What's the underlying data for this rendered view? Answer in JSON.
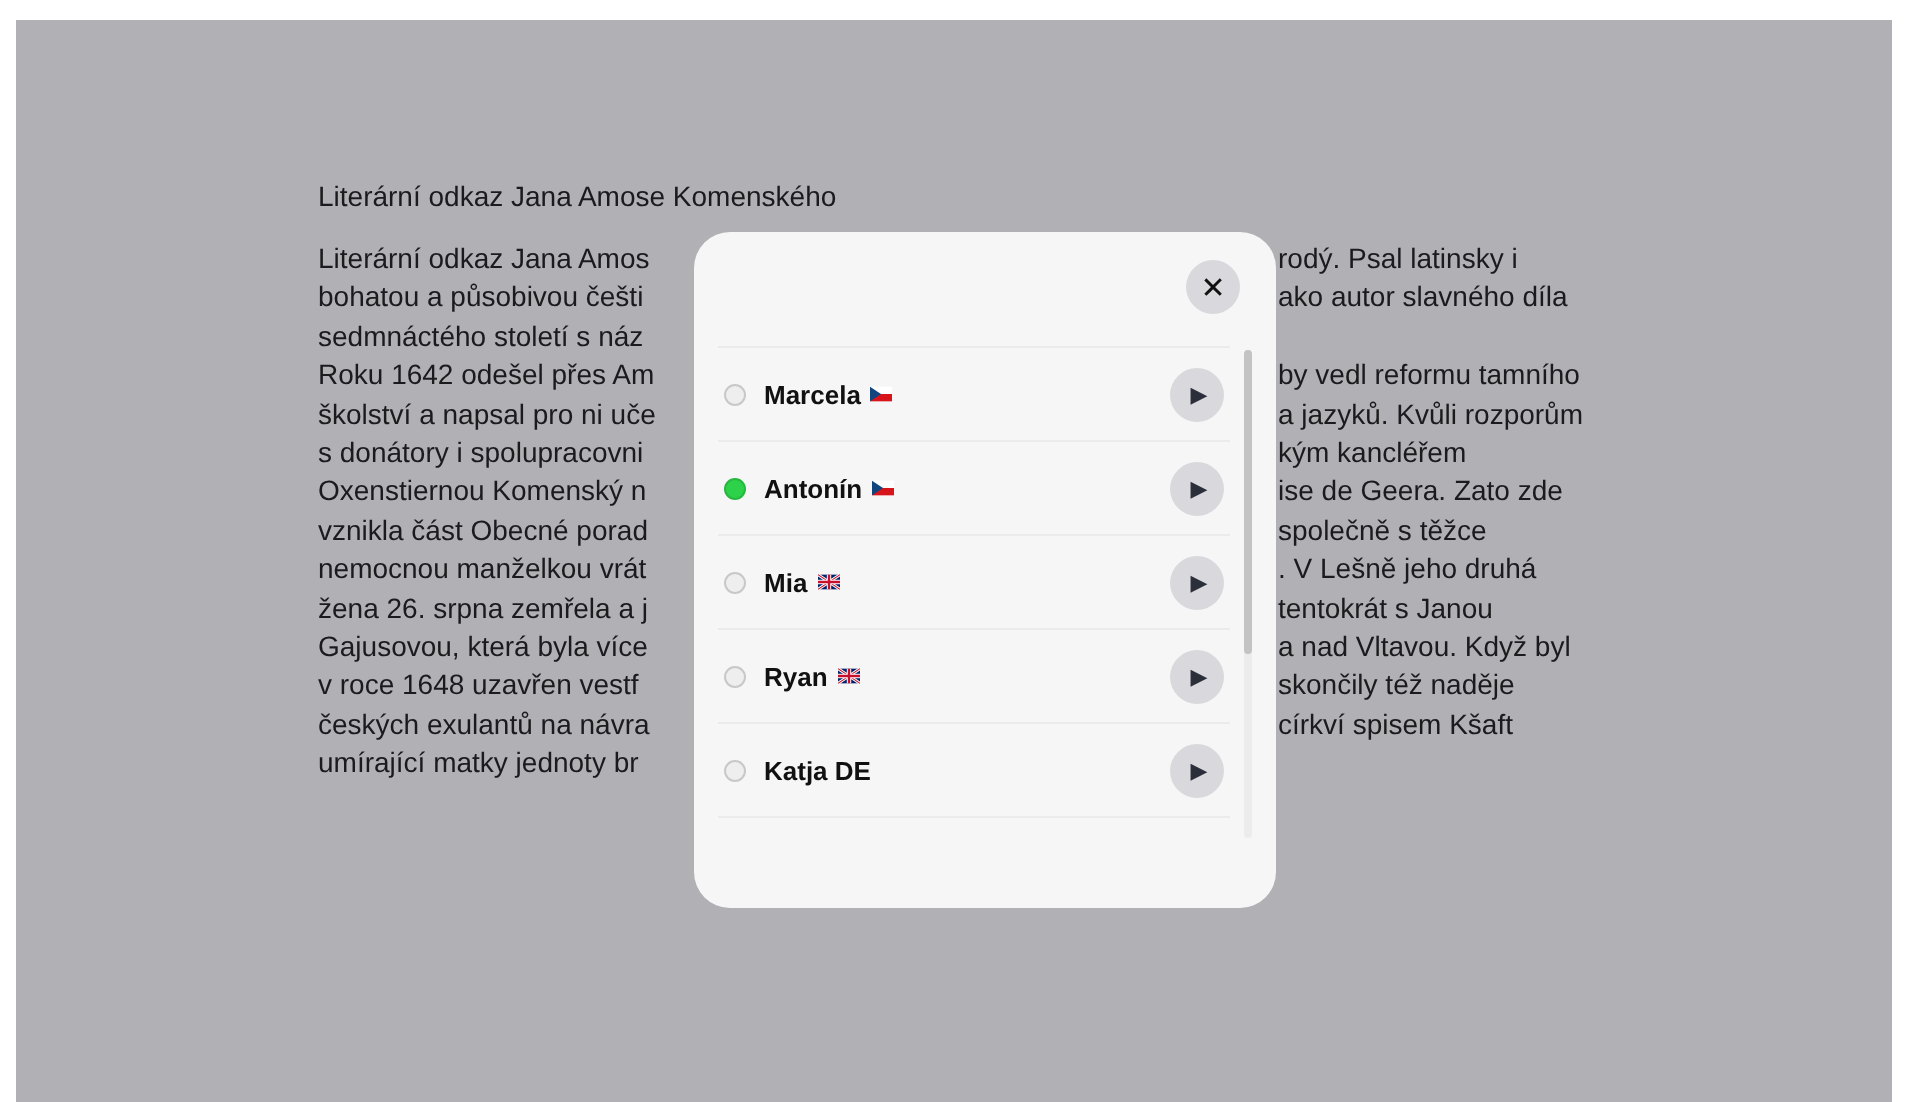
{
  "article": {
    "title": "Literární odkaz Jana Amose Komenského",
    "lines": [
      {
        "left": "Literární odkaz Jana Amos",
        "right": "rodý. Psal latinsky i"
      },
      {
        "left": "bohatou a působivou češti",
        "right": "ako autor slavného díla"
      },
      {
        "left": "sedmnáctého století s náz"
      },
      {
        "left": "Roku 1642 odešel přes Am",
        "right": "by vedl reformu tamního"
      },
      {
        "left": "školství a napsal pro ni uče",
        "right": "a jazyků. Kvůli rozporům"
      },
      {
        "left": "s donátory i spolupracovni",
        "right": "kým kancléřem"
      },
      {
        "left": "Oxenstiernou Komenský n",
        "right": "ise de Geera. Zato zde"
      },
      {
        "left": "vznikla část Obecné porad",
        "right": "společně s těžce"
      },
      {
        "left": "nemocnou manželkou vrát",
        "right": ". V Lešně jeho druhá"
      },
      {
        "left": "žena 26. srpna zemřela a j",
        "right": "tentokrát s Janou"
      },
      {
        "left": "Gajusovou, která byla více",
        "right": "a nad Vltavou. Když byl"
      },
      {
        "left": "v roce 1648 uzavřen vestf",
        "right": "skončily též naděje"
      },
      {
        "left": "českých exulantů na návra",
        "right": "církví spisem Kšaft"
      },
      {
        "left": "umírající matky jednoty br"
      }
    ]
  },
  "dialog": {
    "close": "✕",
    "voices": [
      {
        "name": "Marcela",
        "kind": "cz",
        "selected": false,
        "play": "▶"
      },
      {
        "name": "Antonín",
        "kind": "cz",
        "selected": true,
        "play": "▶"
      },
      {
        "name": "Mia",
        "kind": "gb",
        "selected": false,
        "play": "▶"
      },
      {
        "name": "Ryan",
        "kind": "gb",
        "selected": false,
        "play": "▶"
      },
      {
        "name": "Katja DE",
        "kind": "plain",
        "selected": false,
        "play": "▶"
      }
    ]
  }
}
